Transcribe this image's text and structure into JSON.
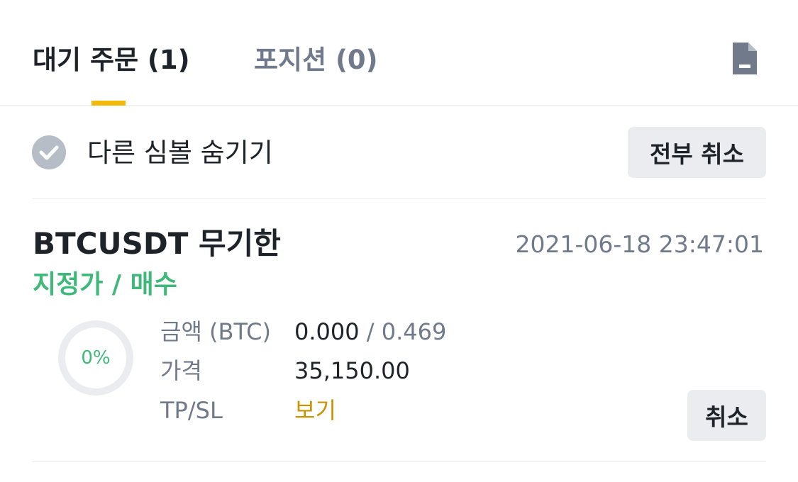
{
  "tabs": {
    "open_orders": "대기 주문 (1)",
    "positions": "포지션  (0)"
  },
  "filter": {
    "hide_other_symbols_label": "다른 심볼 숨기기",
    "hide_other_symbols_checked": true,
    "cancel_all_label": "전부 취소"
  },
  "order": {
    "symbol": "BTCUSDT 무기한",
    "time": "2021-06-18 23:47:01",
    "side": "지정가 / 매수",
    "filled_percent_label": "0%",
    "filled_fraction": 0,
    "amount_label": "금액 (BTC)",
    "amount_filled": "0.000",
    "amount_separator": " / ",
    "amount_total": "0.469",
    "price_label": "가격",
    "price": "35,150.00",
    "tpsl_label": "TP/SL",
    "tpsl_link": "보기",
    "cancel_label": "취소"
  },
  "colors": {
    "accent": "#f0b90b",
    "buy_green": "#3fb97a",
    "link_gold": "#c99400",
    "muted_text": "#707a8a"
  },
  "icons": [
    "document-icon",
    "check-circle-icon"
  ]
}
